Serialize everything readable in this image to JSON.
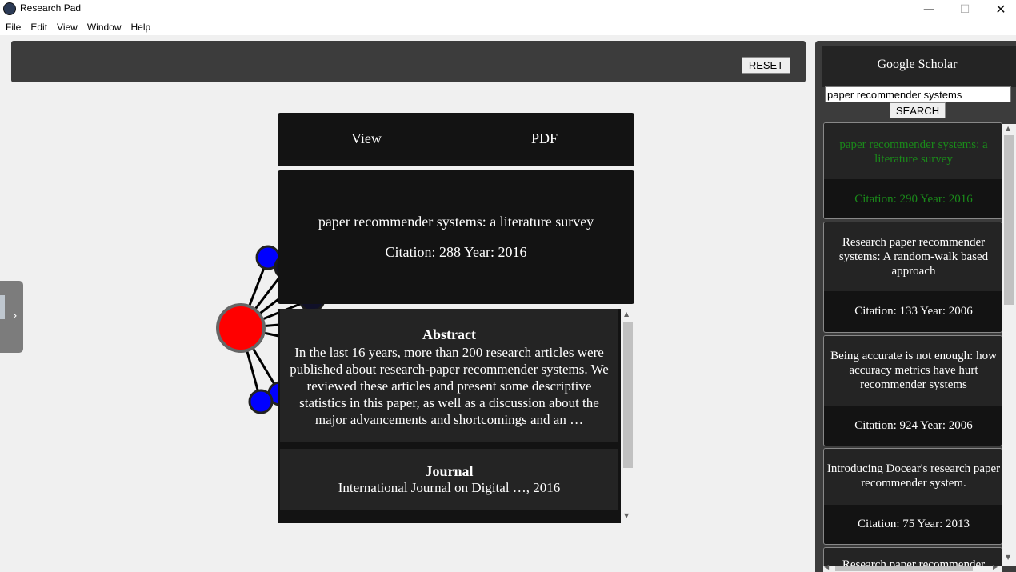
{
  "window": {
    "title": "Research Pad",
    "minimize": "—",
    "maximize": "☐",
    "close": "✕"
  },
  "menu": {
    "items": [
      "File",
      "Edit",
      "View",
      "Window",
      "Help"
    ]
  },
  "toolbar": {
    "reset_label": "RESET"
  },
  "side_tab": {
    "chevron": "›"
  },
  "paper_tabs": {
    "view_label": "View",
    "pdf_label": "PDF"
  },
  "paper": {
    "title": "paper recommender systems: a literature survey",
    "citation_line": "Citation: 288 Year: 2016",
    "abstract_heading": "Abstract",
    "abstract_text": "In the last 16 years, more than 200 research articles were published about research-paper recommender systems. We reviewed these articles and present some descriptive statistics in this paper, as well as a discussion about the major advancements and shortcomings and an …",
    "journal_heading": "Journal",
    "journal_text": "International Journal on Digital …, 2016"
  },
  "graph": {
    "center_color": "#ff0000",
    "node_color": "#0000ff",
    "faded_node_color": "#101028",
    "node_count": 8
  },
  "scholar": {
    "title": "Google Scholar",
    "search_value": "paper recommender systems",
    "search_label": "SEARCH",
    "selected_color": "#1a8a1a",
    "results": [
      {
        "title": "paper recommender systems: a literature survey",
        "citation": "Citation: 290 Year: 2016"
      },
      {
        "title": "Research paper recommender systems: A random-walk based approach",
        "citation": "Citation: 133 Year: 2006"
      },
      {
        "title": "Being accurate is not enough: how accuracy metrics have hurt recommender systems",
        "citation": "Citation: 924 Year: 2006"
      },
      {
        "title": "Introducing Docear's research paper recommender system.",
        "citation": "Citation: 75 Year: 2013"
      },
      {
        "title": "Research paper recommender",
        "citation": ""
      }
    ]
  },
  "scroll": {
    "up": "▲",
    "down": "▼",
    "left": "◀",
    "right": "▶"
  }
}
